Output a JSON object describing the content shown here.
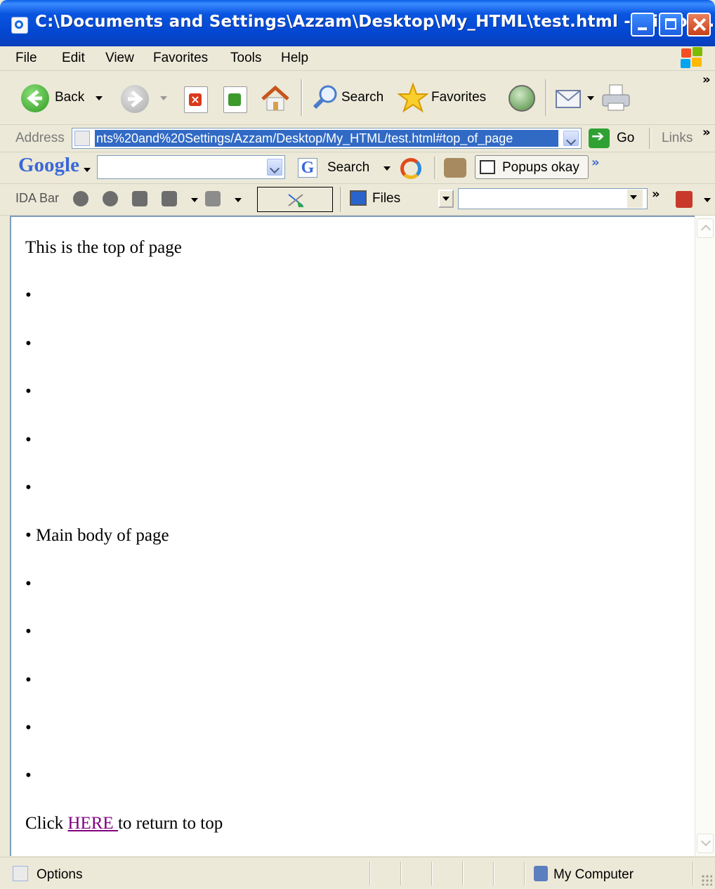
{
  "window": {
    "title": "C:\\Documents and Settings\\Azzam\\Desktop\\My_HTML\\test.html - Microso..."
  },
  "menu": {
    "items": [
      {
        "label": "File",
        "mnemonic": "F"
      },
      {
        "label": "Edit",
        "mnemonic": "E"
      },
      {
        "label": "View",
        "mnemonic": "V"
      },
      {
        "label": "Favorites",
        "mnemonic": "a"
      },
      {
        "label": "Tools",
        "mnemonic": "T"
      },
      {
        "label": "Help",
        "mnemonic": "H"
      }
    ]
  },
  "toolbar": {
    "back_label": "Back",
    "search_label": "Search",
    "favorites_label": "Favorites",
    "more_chevron": "»"
  },
  "address_bar": {
    "label": "Address",
    "url": "nts%20and%20Settings/Azzam/Desktop/My_HTML/test.html#top_of_page",
    "go_label": "Go",
    "links_label": "Links"
  },
  "google_toolbar": {
    "logo": "Google",
    "search_value": "",
    "search_label": "Search",
    "popups_label": "Popups okay"
  },
  "ida_bar": {
    "label": "IDA Bar",
    "files_label": "Files",
    "input_value": ""
  },
  "page": {
    "top_text": "This is the top of page",
    "bullet": "•",
    "main_body_text": "Main body of page",
    "click_prefix": "Click ",
    "link_text": "HERE ",
    "click_suffix": "to return to top"
  },
  "status_bar": {
    "left_text": "Options",
    "zone_text": "My Computer"
  },
  "colors": {
    "title_bar": "#0347d1",
    "selection": "#316ac5",
    "visited_link": "#800080"
  }
}
